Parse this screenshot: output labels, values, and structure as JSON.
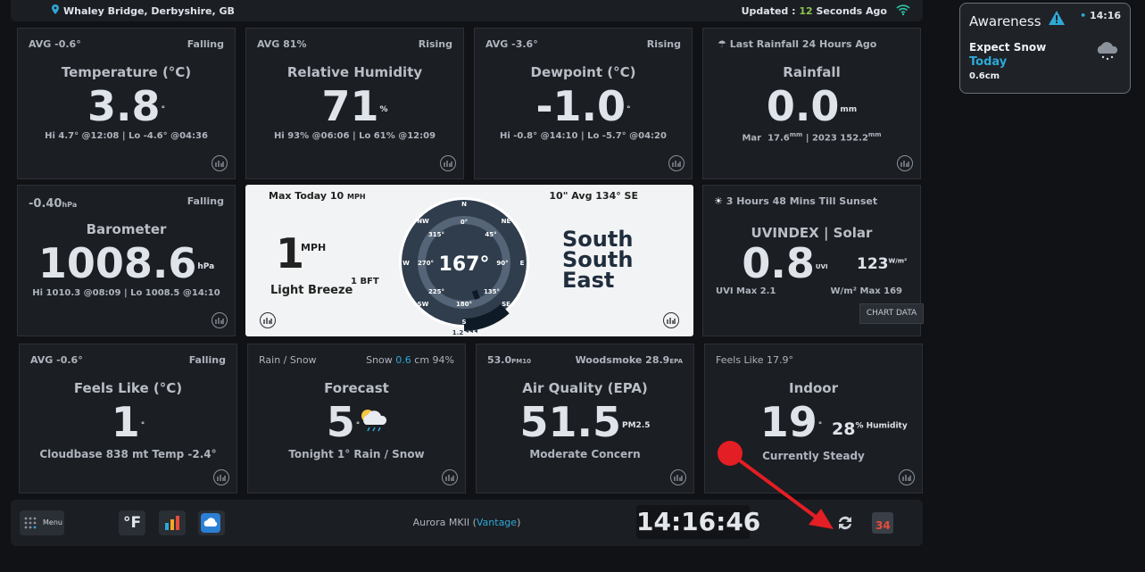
{
  "topbar": {
    "location": "Whaley Bridge, Derbyshire, GB",
    "updated_prefix": "Updated : ",
    "updated_num": "12",
    "updated_suffix": " Seconds Ago"
  },
  "cards": {
    "temperature": {
      "tl": "AVG -0.6°",
      "tr": "Falling",
      "title": "Temperature (°C)",
      "value": "3.8",
      "unit": "°",
      "sub": "Hi 4.7° @12:08 | Lo -4.6° @04:36"
    },
    "humidity": {
      "tl": "AVG 81%",
      "tr": "Rising",
      "title": "Relative Humidity",
      "value": "71",
      "unit": "%",
      "sub": "Hi 93% @06:06 | Lo 61% @12:09"
    },
    "dewpoint": {
      "tl": "AVG -3.6°",
      "tr": "Rising",
      "title": "Dewpoint (°C)",
      "value": "-1.0",
      "unit": "°",
      "sub": "Hi -0.8° @14:10 | Lo -5.7° @04:20"
    },
    "rainfall": {
      "tl": "Last Rainfall 24 Hours Ago",
      "title": "Rainfall",
      "value": "0.0",
      "unit": "mm",
      "sub_month": "Mar",
      "sub_month_val": "17.6",
      "sub_unit": "mm",
      "sub_year": "| 2023 152.2",
      "sub_year_unit": "mm"
    },
    "barometer": {
      "tl": "-0.40",
      "tl_unit": "hPa",
      "tr": "Falling",
      "title": "Barometer",
      "value": "1008.6",
      "unit": "hPa",
      "sub": "Hi 1010.3 @08:09 | Lo 1008.5 @14:10"
    },
    "uv": {
      "tl": "3 Hours 48 Mins Till Sunset",
      "title": "UVINDEX | Solar",
      "value": "0.8",
      "unit": "UVI",
      "solar": "123",
      "solar_unit": "W/m²",
      "sub_left": "UVI Max 2.1",
      "sub_right": "W/m² Max 169",
      "tip": "CHART DATA"
    },
    "feelslike": {
      "tl": "AVG -0.6°",
      "tr": "Falling",
      "title": "Feels Like (°C)",
      "value": "1",
      "unit": "°",
      "sub": "Cloudbase 838 mt Temp -2.4°"
    },
    "forecast": {
      "tl": "Rain / Snow",
      "tr_prefix": "Snow ",
      "tr_num": "0.6",
      "tr_suffix": " cm 94%",
      "title": "Forecast",
      "value": "5",
      "unit": "°",
      "sub": "Tonight 1° Rain / Snow"
    },
    "airquality": {
      "tl": "53.0",
      "tl_unit": "PM10",
      "tr": "Woodsmoke 28.9",
      "tr_unit": "EPA",
      "title": "Air Quality (EPA)",
      "value": "51.5",
      "unit": "PM2.5",
      "sub": "Moderate Concern"
    },
    "indoor": {
      "tl": "Feels Like 17.9°",
      "title": "Indoor",
      "value": "19",
      "unit": "°",
      "humidity": "28",
      "humidity_unit": "% Humidity",
      "sub": "Currently Steady"
    }
  },
  "wind": {
    "max_prefix": "Max Today 10 ",
    "max_unit": "MPH",
    "avg": "10\" Avg 134° SE",
    "speed": "1",
    "speed_unit": "MPH",
    "bft": "1 BFT",
    "desc": "Light Breeze",
    "degrees": "167°",
    "direction_line1": "South",
    "direction_line2": "South",
    "direction_line3": "East",
    "compass_labels": {
      "n": "N",
      "ne": "NE",
      "e": "E",
      "se": "SE",
      "s": "S",
      "sw": "SW",
      "w": "W",
      "nw": "NW",
      "d0": "0°",
      "d45": "45°",
      "d90": "90°",
      "d135": "135°",
      "d180": "180°",
      "d225": "225°",
      "d270": "270°",
      "d315": "315°"
    },
    "gust_label": "1.2"
  },
  "awareness": {
    "title": "Awareness",
    "time": "14:16",
    "line1": "Expect Snow",
    "line2": "Today",
    "line3": "0.6cm"
  },
  "bottombar": {
    "menu": "Menu",
    "unit_toggle": "°F",
    "station_prefix": "Aurora MKII (",
    "station_link": "Vantage",
    "station_suffix": ")",
    "clock": "14:16:46"
  },
  "colors": {
    "accent": "#2ea8d6",
    "alert": "#2ea8d6",
    "annotation": "#e31e24",
    "card": "#1b1e23",
    "wind_card": "#f2f3f4"
  }
}
